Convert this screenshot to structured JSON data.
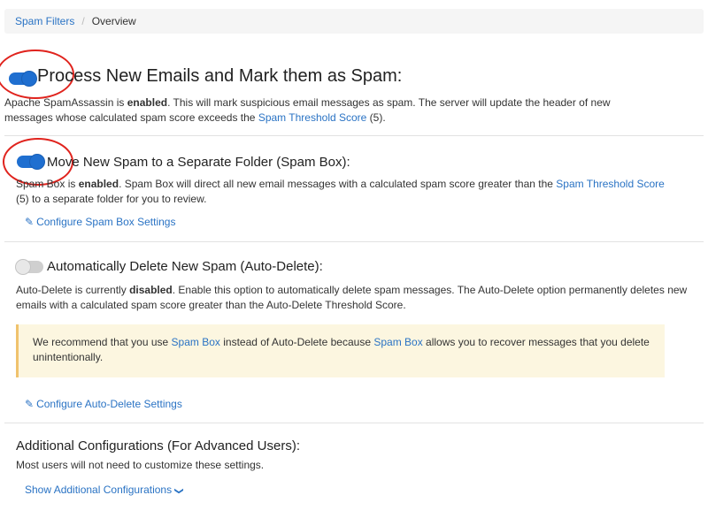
{
  "breadcrumb": {
    "parent": "Spam Filters",
    "separator": "/",
    "current": "Overview"
  },
  "process": {
    "title": "Process New Emails and Mark them as Spam:",
    "toggle_state": "on",
    "desc_part1": "Apache SpamAssassin is ",
    "desc_bold": "enabled",
    "desc_part2": ". This will mark suspicious email messages as spam. The server will update the header of new messages whose calculated spam score exceeds the ",
    "desc_link": "Spam Threshold Score",
    "desc_part3": " (5)."
  },
  "spambox": {
    "title": "Move New Spam to a Separate Folder (Spam Box):",
    "toggle_state": "on",
    "desc_part1": "Spam Box is ",
    "desc_bold": "enabled",
    "desc_part2": ". Spam Box will direct all new email messages with a calculated spam score greater than the ",
    "desc_link": "Spam Threshold Score",
    "desc_part3": " (5) to a separate folder for you to review.",
    "configure_label": "Configure Spam Box Settings"
  },
  "autodelete": {
    "title": "Automatically Delete New Spam (Auto-Delete):",
    "toggle_state": "off",
    "desc_part1": "Auto-Delete is currently ",
    "desc_bold": "disabled",
    "desc_part2": ". Enable this option to automatically delete spam messages. The Auto-Delete option permanently deletes new emails with a calculated spam score greater than the Auto-Delete Threshold Score.",
    "alert_part1": "We recommend that you use ",
    "alert_link1": "Spam Box",
    "alert_part2": " instead of Auto-Delete because ",
    "alert_link2": "Spam Box",
    "alert_part3": " allows you to recover messages that you delete unintentionally.",
    "configure_label": "Configure Auto-Delete Settings"
  },
  "additional": {
    "title": "Additional Configurations (For Advanced Users):",
    "desc": "Most users will not need to customize these settings.",
    "show_label": "Show Additional Configurations"
  },
  "colors": {
    "link": "#2a73c4",
    "toggle_on": "#1f6fd0",
    "annotation": "#e0231d",
    "alert_bg": "#fcf6e0"
  },
  "icons": [
    "pencil-icon",
    "chevron-down-icon"
  ]
}
